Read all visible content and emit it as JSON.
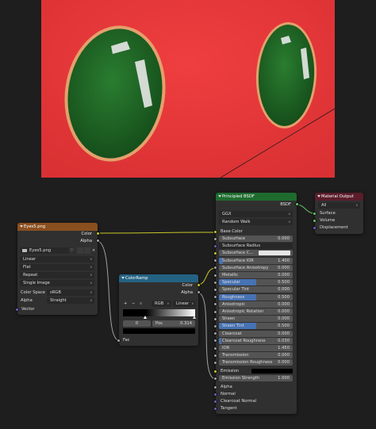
{
  "image_node": {
    "title": "Eyes5.png",
    "out_color": "Color",
    "out_alpha": "Alpha",
    "image_name": "Eyes5.png",
    "interpolation": "Linear",
    "projection": "Flat",
    "extension": "Repeat",
    "source": "Single Image",
    "color_space_label": "Color Space",
    "color_space": "sRGB",
    "alpha_label": "Alpha",
    "alpha_mode": "Straight",
    "in_vector": "Vector"
  },
  "colorramp_node": {
    "title": "ColorRamp",
    "out_color": "Color",
    "out_alpha": "Alpha",
    "plus": "+",
    "minus": "−",
    "mode": "RGB",
    "interp": "Linear",
    "stop_index": "0",
    "pos_label": "Pos",
    "pos_value": "0.314",
    "in_fac": "Fac"
  },
  "bsdf_node": {
    "title": "Principled BSDF",
    "out_bsdf": "BSDF",
    "distribution": "GGX",
    "subsurface_method": "Random Walk",
    "base_color": "Base Color",
    "fields": [
      {
        "label": "Subsurface",
        "value": "0.000",
        "fill": 0
      },
      {
        "label": "Subsurface Radius",
        "value": "",
        "fill": 0
      },
      {
        "label": "Subsurface C...",
        "value": "",
        "fill": 0
      },
      {
        "label": "Subsurface IOR",
        "value": "1.400",
        "fill": 0.05
      },
      {
        "label": "Subsurface Anisotropy",
        "value": "0.000",
        "fill": 0
      },
      {
        "label": "Metallic",
        "value": "0.000",
        "fill": 0
      },
      {
        "label": "Specular",
        "value": "0.500",
        "fill": 0.5
      },
      {
        "label": "Specular Tint",
        "value": "0.000",
        "fill": 0
      },
      {
        "label": "Roughness",
        "value": "0.500",
        "fill": 0.5
      },
      {
        "label": "Anisotropic",
        "value": "0.000",
        "fill": 0
      },
      {
        "label": "Anisotropic Rotation",
        "value": "0.000",
        "fill": 0
      },
      {
        "label": "Sheen",
        "value": "0.000",
        "fill": 0
      },
      {
        "label": "Sheen Tint",
        "value": "0.500",
        "fill": 0.5
      },
      {
        "label": "Clearcoat",
        "value": "0.000",
        "fill": 0
      },
      {
        "label": "Clearcoat Roughness",
        "value": "0.030",
        "fill": 0.03
      },
      {
        "label": "IOR",
        "value": "1.450",
        "fill": 0
      },
      {
        "label": "Transmission",
        "value": "0.000",
        "fill": 0
      },
      {
        "label": "Transmission Roughness",
        "value": "0.000",
        "fill": 0
      }
    ],
    "emission": "Emission",
    "emission_strength": "Emission Strength",
    "emission_strength_value": "1.000",
    "alpha": "Alpha",
    "normal": "Normal",
    "clearcoat_normal": "Clearcoat Normal",
    "tangent": "Tangent"
  },
  "output_node": {
    "title": "Material Output",
    "target": "All",
    "surface": "Surface",
    "volume": "Volume",
    "displacement": "Displacement"
  },
  "colors": {
    "image_header": "#8a4f1f",
    "converter_header": "#246283",
    "shader_header": "#1f6b2e",
    "output_header": "#5a1d2a",
    "render_bg": "#e8373a",
    "eye_fill": "#1f6b28",
    "eye_rim": "#e0a06b"
  }
}
